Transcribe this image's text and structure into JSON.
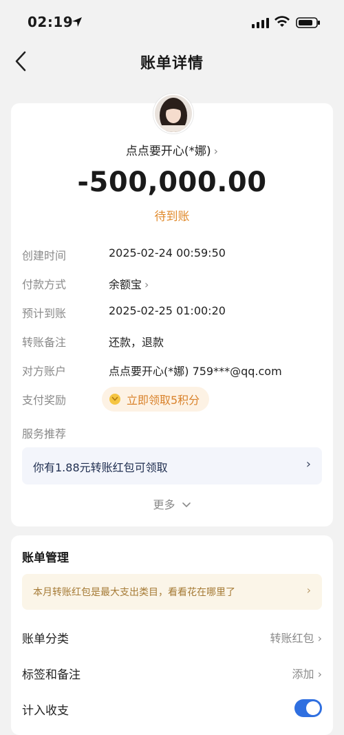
{
  "status_bar": {
    "time": "02:19"
  },
  "nav": {
    "title": "账单详情"
  },
  "summary": {
    "payee": "点点要开心(*娜)",
    "amount": "-500,000.00",
    "status": "待到账"
  },
  "details": [
    {
      "label": "创建时间",
      "value": "2025-02-24 00:59:50"
    },
    {
      "label": "付款方式",
      "value": "余额宝"
    },
    {
      "label": "预计到账",
      "value": "2025-02-25 01:00:20"
    },
    {
      "label": "转账备注",
      "value": "还款，退款"
    },
    {
      "label": "对方账户",
      "value": "点点要开心(*娜) 759***@qq.com"
    },
    {
      "label": "支付奖励",
      "value": "立即领取5积分"
    },
    {
      "label": "服务推荐"
    }
  ],
  "service_recommend": {
    "text": "你有1.88元转账红包可领取"
  },
  "more": {
    "label": "更多"
  },
  "bill_management": {
    "title": "账单管理",
    "tip": "本月转账红包是最大支出类目，看看花在哪里了",
    "category": {
      "label": "账单分类",
      "value": "转账红包"
    },
    "tags": {
      "label": "标签和备注",
      "value": "添加"
    },
    "include": {
      "label": "计入收支",
      "enabled": true
    }
  },
  "colors": {
    "accent_orange": "#e08a2c",
    "toggle_blue": "#2f6fe0"
  }
}
